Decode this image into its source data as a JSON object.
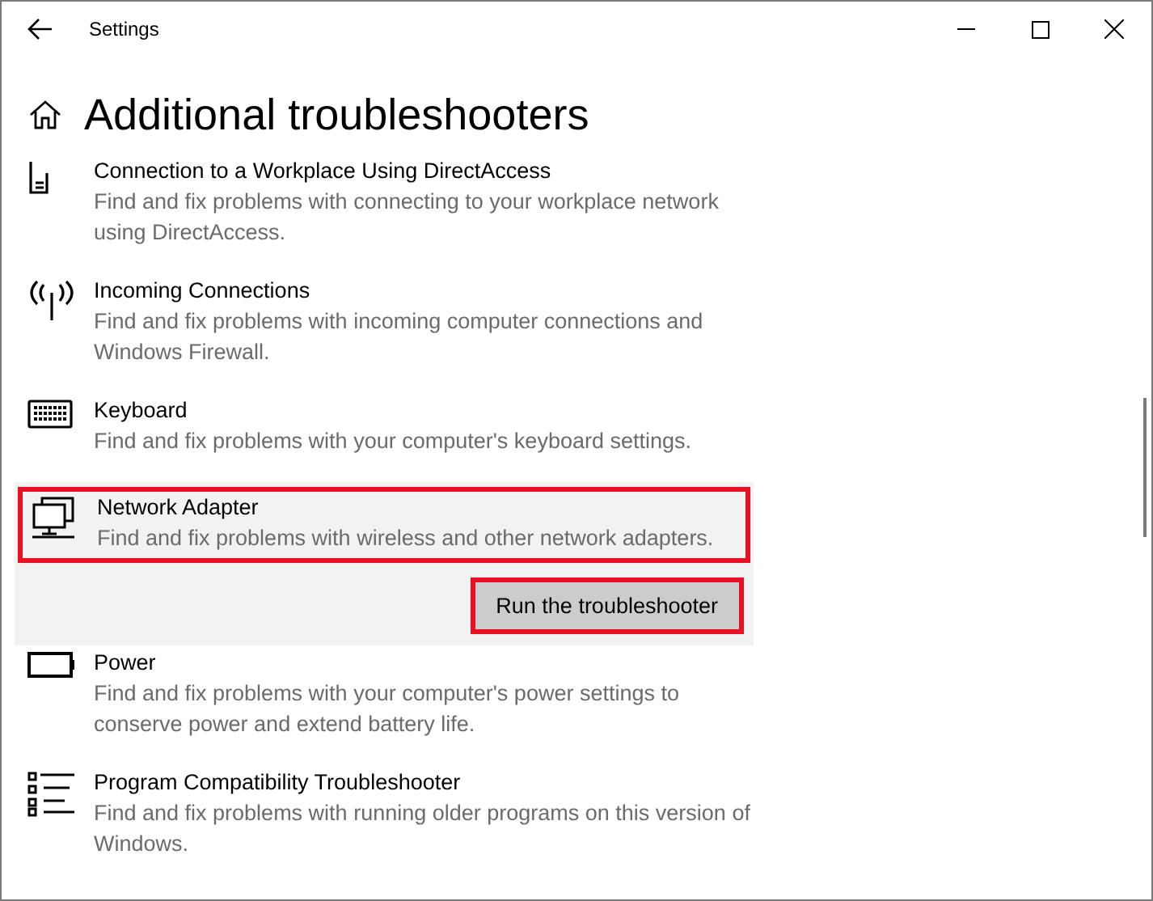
{
  "window": {
    "title": "Settings"
  },
  "page": {
    "title": "Additional troubleshooters"
  },
  "troubleshooters": [
    {
      "title": "Connection to a Workplace Using DirectAccess",
      "description": "Find and fix problems with connecting to your workplace network using DirectAccess.",
      "selected": false,
      "annotated": false
    },
    {
      "title": "Incoming Connections",
      "description": "Find and fix problems with incoming computer connections and Windows Firewall.",
      "selected": false,
      "annotated": false
    },
    {
      "title": "Keyboard",
      "description": "Find and fix problems with your computer's keyboard settings.",
      "selected": false,
      "annotated": false
    },
    {
      "title": "Network Adapter",
      "description": "Find and fix problems with wireless and other network adapters.",
      "selected": true,
      "annotated": true
    },
    {
      "title": "Power",
      "description": "Find and fix problems with your computer's power settings to conserve power and extend battery life.",
      "selected": false,
      "annotated": false
    },
    {
      "title": "Program Compatibility Troubleshooter",
      "description": "Find and fix problems with running older programs on this version of Windows.",
      "selected": false,
      "annotated": false
    }
  ],
  "run_button": {
    "label": "Run the troubleshooter",
    "annotated": true
  }
}
